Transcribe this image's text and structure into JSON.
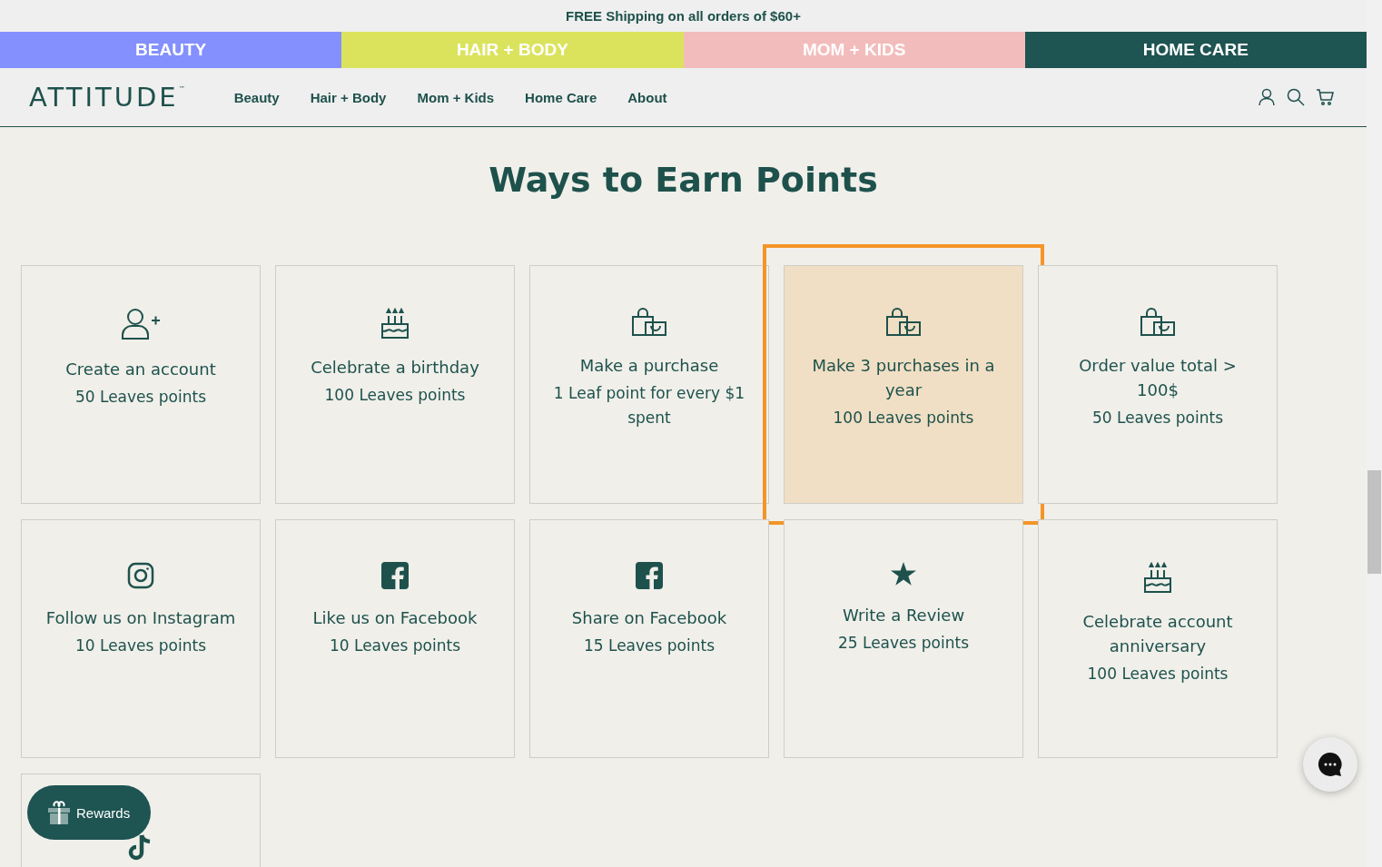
{
  "announcement": "FREE Shipping on all orders of $60+",
  "categories": [
    {
      "label": "BEAUTY",
      "color": "#8490fd"
    },
    {
      "label": "HAIR + BODY",
      "color": "#dbe35d"
    },
    {
      "label": "MOM + KIDS",
      "color": "#f3bcbc"
    },
    {
      "label": "HOME CARE",
      "color": "#1e5451"
    }
  ],
  "header": {
    "logo": "ATTITUDE",
    "logo_mark": "™",
    "nav": [
      "Beauty",
      "Hair + Body",
      "Mom + Kids",
      "Home Care",
      "About"
    ]
  },
  "section_title": "Ways to Earn Points",
  "cards": [
    {
      "kind": "account",
      "title": "Create an account",
      "points": "50 Leaves points",
      "highlighted": false
    },
    {
      "kind": "birthday",
      "title": "Celebrate a birthday",
      "points": "100 Leaves points",
      "highlighted": false
    },
    {
      "kind": "purchase",
      "title": "Make a purchase",
      "points": "1 Leaf point for every $1 spent",
      "highlighted": false
    },
    {
      "kind": "purchase",
      "title": "Make 3 purchases in a year",
      "points": "100 Leaves points",
      "highlighted": true
    },
    {
      "kind": "purchase",
      "title": "Order value total > 100$",
      "points": "50 Leaves points",
      "highlighted": false
    },
    {
      "kind": "instagram",
      "title": "Follow us on Instagram",
      "points": "10 Leaves points",
      "highlighted": false
    },
    {
      "kind": "facebook",
      "title": "Like us on Facebook",
      "points": "10 Leaves points",
      "highlighted": false
    },
    {
      "kind": "facebook",
      "title": "Share on Facebook",
      "points": "15 Leaves points",
      "highlighted": false
    },
    {
      "kind": "review",
      "title": "Write a Review",
      "points": "25 Leaves points",
      "highlighted": false
    },
    {
      "kind": "birthday",
      "title": "Celebrate account anniversary",
      "points": "100 Leaves points",
      "highlighted": false
    },
    {
      "kind": "tiktok",
      "highlighted": false
    }
  ],
  "rewards_button": "Rewards"
}
